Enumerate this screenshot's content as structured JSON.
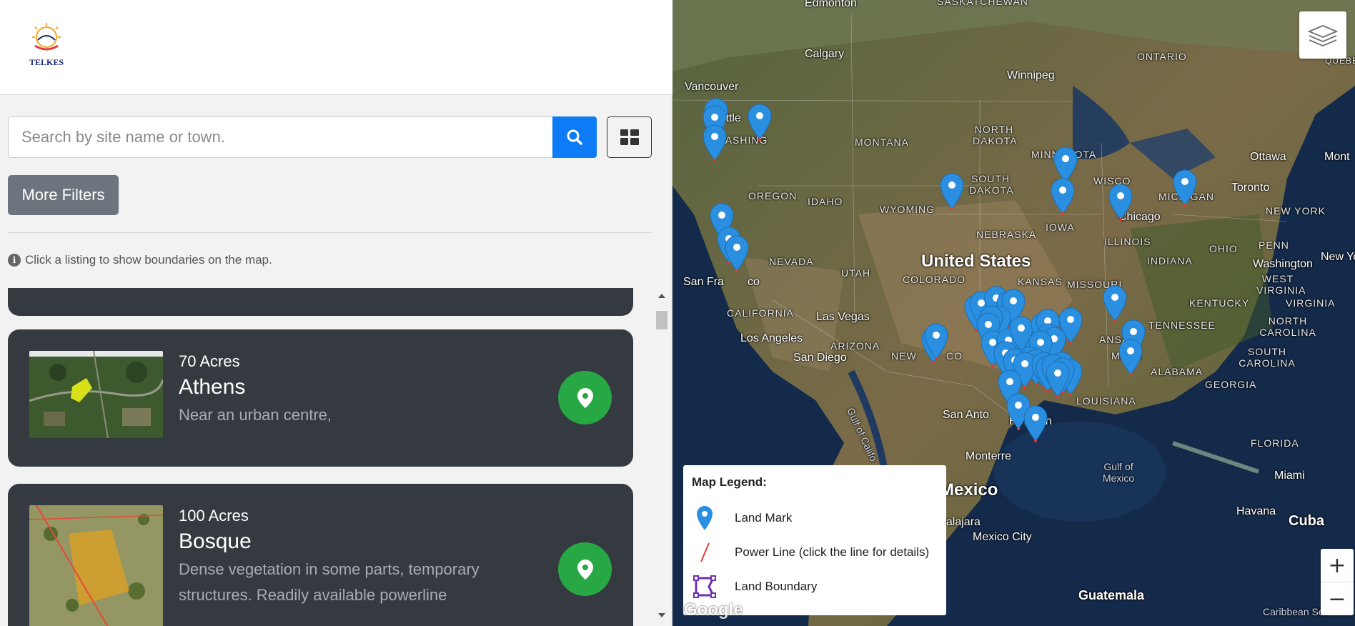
{
  "brand": {
    "logo_text": "TELKES"
  },
  "search": {
    "placeholder": "Search by site name or town."
  },
  "filters": {
    "label": "More Filters"
  },
  "hint": "Click a listing to show boundaries on the map.",
  "listings": [
    {
      "acres": "70 Acres",
      "name": "Athens",
      "description": "Near an urban centre,"
    },
    {
      "acres": "100 Acres",
      "name": "Bosque",
      "description": "Dense vegetation in some parts, temporary structures. Readily available powerline"
    }
  ],
  "map": {
    "labels": {
      "edmonton": "Edmonton",
      "saskatchewan": "SASKATCHEWAN",
      "calgary": "Calgary",
      "vancouver": "Vancouver",
      "seattle": "Seattle",
      "washington_state": "WASHING",
      "montana": "MONTANA",
      "north_dakota": "NORTH DAKOTA",
      "minnesota": "MINNESOTA",
      "ontario": "ONTARIO",
      "quebec": "QUEBEC",
      "winnipeg": "Winnipeg",
      "oregon": "OREGON",
      "idaho": "IDAHO",
      "wyoming": "WYOMING",
      "south_dakota": "SOUTH DAKOTA",
      "wisconsin": "WISCO",
      "michigan": "MICHIGAN",
      "ottawa": "Ottawa",
      "toronto": "Toronto",
      "montreal": "Mont",
      "new_york": "NEW YORK",
      "iowa": "IOWA",
      "chicago": "Chicago",
      "nebraska": "NEBRASKA",
      "nevada": "NEVADA",
      "utah": "UTAH",
      "colorado": "COLORADO",
      "united_states": "United States",
      "kansas": "KANSAS",
      "missouri": "MISSOURI",
      "illinois": "ILLINOIS",
      "indiana": "INDIANA",
      "ohio": "OHIO",
      "penn": "PENN",
      "washington_dc": "Washington",
      "new_york_city": "New York",
      "san_francisco": "San Fra",
      "san_francisco_tail": "co",
      "california": "CALIFORNIA",
      "las_vegas": "Las Vegas",
      "los_angeles": "Los Angeles",
      "san_diego": "San Diego",
      "arizona": "ARIZONA",
      "new_mexico": "NEW",
      "new_mexico_tail": "CO",
      "arkansas": "ANSAS",
      "tennessee": "TENNESSEE",
      "kentucky": "KENTUCKY",
      "west_virginia": "WEST VIRGINIA",
      "virginia": "VIRGINIA",
      "north_carolina": "NORTH CAROLINA",
      "south_carolina": "SOUTH CAROLINA",
      "mississippi": "MISSI",
      "alabama": "ALABAMA",
      "georgia": "GEORGIA",
      "louisiana": "LOUISIANA",
      "san_antonio": "San Anto",
      "houston": "Houston",
      "florida": "FLORIDA",
      "gulf_of_california": "Gulf of Califo",
      "monterrey": "Monterre",
      "gulf_of_mexico": "Gulf of Mexico",
      "miami": "Miami",
      "havana": "Havana",
      "cuba": "Cuba",
      "mexico": "Mexico",
      "guadalajara": "dalajara",
      "mexico_city": "Mexico City",
      "guatemala": "Guatemala",
      "caribbean_sea": "Caribbean Sea"
    },
    "google": "Google",
    "legend": {
      "title": "Map Legend:",
      "items": [
        {
          "label": "Land Mark",
          "icon": "map-marker-icon"
        },
        {
          "label": "Power Line (click the line for details)",
          "icon": "power-line-icon"
        },
        {
          "label": "Land Boundary",
          "icon": "boundary-icon"
        }
      ]
    },
    "zoom_in": "+",
    "zoom_out": "−"
  },
  "colors": {
    "accent": "#0d7bf5",
    "card_bg": "#343a40",
    "pin_green": "#28a745",
    "marker_blue": "#2a8fe0"
  }
}
